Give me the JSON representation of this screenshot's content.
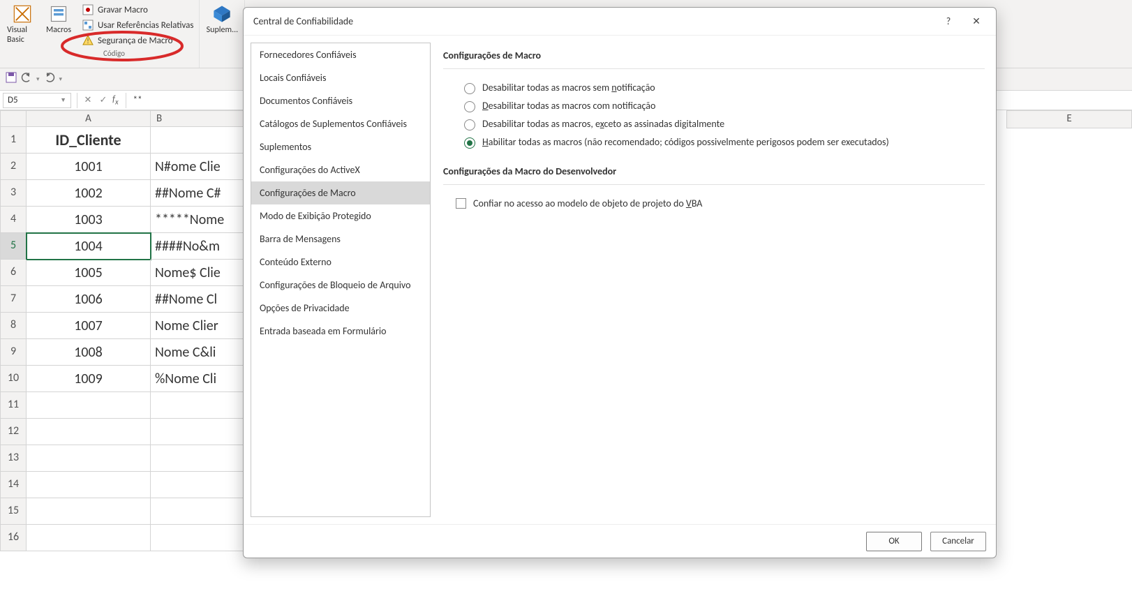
{
  "ribbon": {
    "visual_basic": "Visual Basic",
    "macros": "Macros",
    "gravar": "Gravar Macro",
    "referencias": "Usar Referências Relativas",
    "seguranca": "Segurança de Macro",
    "codigo_group": "Código",
    "suplem": "Suplem..."
  },
  "formula": {
    "name_box": "D5",
    "content": "**"
  },
  "columns": {
    "A": "A",
    "B": "B",
    "E": "E"
  },
  "rows": [
    "1",
    "2",
    "3",
    "4",
    "5",
    "6",
    "7",
    "8",
    "9",
    "10",
    "11",
    "12",
    "13",
    "14",
    "15",
    "16"
  ],
  "sheet": {
    "header_a": "ID_Cliente",
    "data": [
      {
        "a": "1001",
        "b": "N#ome Clie"
      },
      {
        "a": "1002",
        "b": "##Nome C#"
      },
      {
        "a": "1003",
        "b": "*****Nome"
      },
      {
        "a": "1004",
        "b": "####No&m"
      },
      {
        "a": "1005",
        "b": "Nome$ Clie"
      },
      {
        "a": "1006",
        "b": "##Nome Cl"
      },
      {
        "a": "1007",
        "b": "Nome Clier"
      },
      {
        "a": "1008",
        "b": "Nome C&li"
      },
      {
        "a": "1009",
        "b": "%Nome Cli"
      }
    ]
  },
  "dialog": {
    "title": "Central de Confiabilidade",
    "help_char": "?",
    "close_char": "✕",
    "sidebar": [
      "Fornecedores Confiáveis",
      "Locais Confiáveis",
      "Documentos Confiáveis",
      "Catálogos de Suplementos Confiáveis",
      "Suplementos",
      "Configurações do ActiveX",
      "Configurações de Macro",
      "Modo de Exibição Protegido",
      "Barra de Mensagens",
      "Conteúdo Externo",
      "Configurações de Bloqueio de Arquivo",
      "Opções de Privacidade",
      "Entrada baseada em Formulário"
    ],
    "sidebar_selected_index": 6,
    "section1": "Configurações de Macro",
    "radios": [
      {
        "pre": "Desabilitar todas as macros sem ",
        "key": "n",
        "post": "otificação"
      },
      {
        "pre": "",
        "key": "D",
        "post": "esabilitar todas as macros com notificação"
      },
      {
        "pre": "Desabilitar todas as macros, e",
        "key": "x",
        "post": "ceto as assinadas digitalmente"
      },
      {
        "pre": "",
        "key": "H",
        "post": "abilitar todas as macros (não recomendado; códigos possivelmente perigosos podem ser executados)"
      }
    ],
    "radio_checked_index": 3,
    "section2": "Configurações da Macro do Desenvolvedor",
    "checkbox": {
      "pre": "Confiar no acesso ao modelo de objeto de projeto do ",
      "key": "V",
      "post": "BA"
    },
    "ok": "OK",
    "cancel": "Cancelar"
  }
}
